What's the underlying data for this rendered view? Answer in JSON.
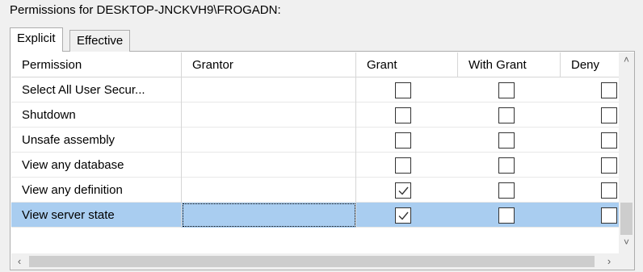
{
  "header": {
    "title": "Permissions for DESKTOP-JNCKVH9\\FROGADN:"
  },
  "tabs": [
    {
      "label": "Explicit",
      "active": true
    },
    {
      "label": "Effective",
      "active": false
    }
  ],
  "grid": {
    "columns": [
      "Permission",
      "Grantor",
      "Grant",
      "With Grant",
      "Deny"
    ],
    "rows": [
      {
        "permission": "Select All User Secur...",
        "grantor": "",
        "grant": false,
        "with_grant": false,
        "deny": false,
        "selected": false
      },
      {
        "permission": "Shutdown",
        "grantor": "",
        "grant": false,
        "with_grant": false,
        "deny": false,
        "selected": false
      },
      {
        "permission": "Unsafe assembly",
        "grantor": "",
        "grant": false,
        "with_grant": false,
        "deny": false,
        "selected": false
      },
      {
        "permission": "View any database",
        "grantor": "",
        "grant": false,
        "with_grant": false,
        "deny": false,
        "selected": false
      },
      {
        "permission": "View any definition",
        "grantor": "",
        "grant": true,
        "with_grant": false,
        "deny": false,
        "selected": false
      },
      {
        "permission": "View server state",
        "grantor": "",
        "grant": true,
        "with_grant": false,
        "deny": false,
        "selected": true
      }
    ]
  },
  "scrollbars": {
    "vertical": {
      "up_icon": "chevron-up-icon",
      "down_icon": "chevron-down-icon",
      "position": 1.0
    },
    "horizontal": {
      "left_icon": "chevron-left-icon",
      "right_icon": "chevron-right-icon",
      "position": 0.0
    }
  },
  "colors": {
    "selection": "#a9cdf0",
    "border": "#adadad",
    "check": "#333333"
  }
}
